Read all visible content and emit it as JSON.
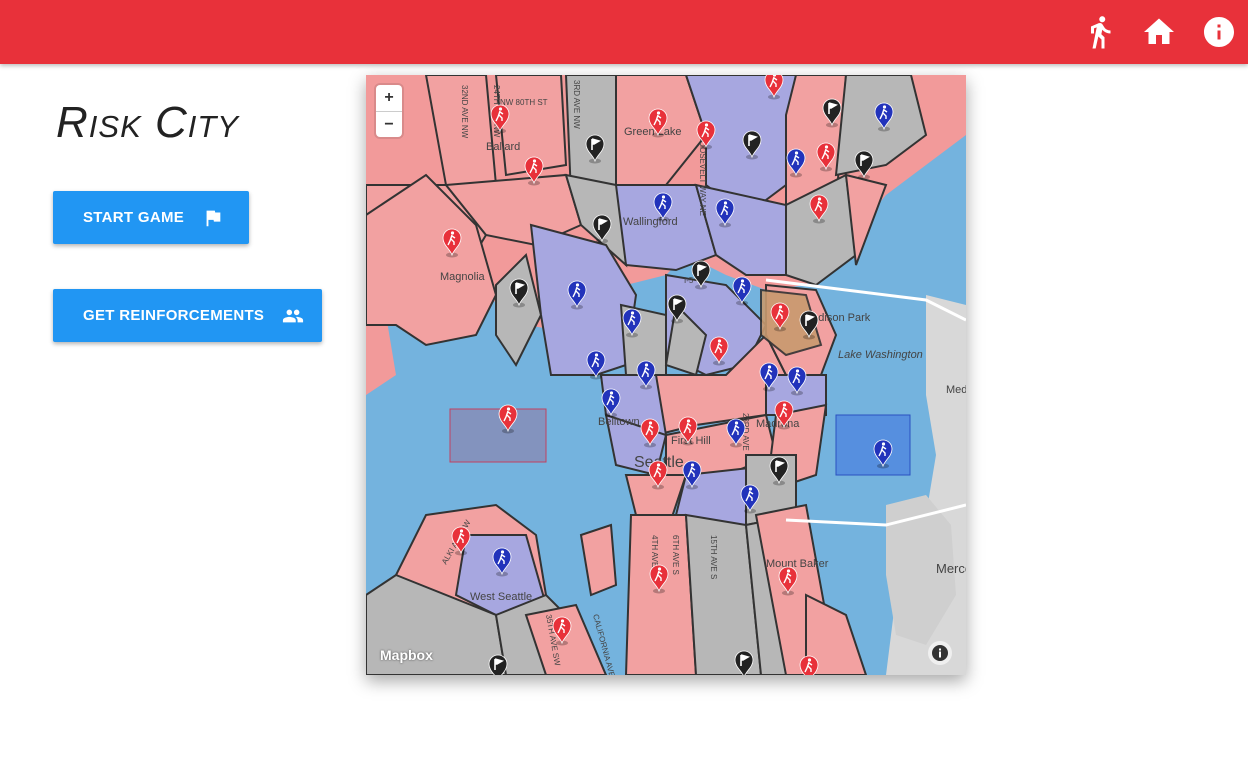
{
  "header": {
    "icons": [
      "walk-icon",
      "home-icon",
      "info-icon"
    ]
  },
  "title": "Risk City",
  "buttons": {
    "start_game": "START GAME",
    "get_reinforcements": "GET REINFORCEMENTS"
  },
  "map": {
    "zoom_in": "+",
    "zoom_out": "−",
    "attribution": "Mapbox",
    "labels": [
      "Ballard",
      "Green Lake",
      "Wallingford",
      "Magnolia",
      "Madison Park",
      "Lake Washington",
      "Belltown",
      "First Hill",
      "Seattle",
      "Madrona",
      "West Seattle",
      "Mount Baker",
      "Mercer Island",
      "Medina"
    ],
    "street_labels": [
      "32ND AVE NW",
      "24TH AVE NW",
      "NW 80TH ST",
      "3RD AVE NW",
      "ROOSEVELT WAY NE",
      "I-5",
      "23RD AVE",
      "4TH AVE S",
      "6TH AVE S",
      "15TH AVE S",
      "ALKI AVE SW",
      "CALIFORNIA AVE SW",
      "35TH AVE SW"
    ]
  },
  "colors": {
    "topbar": "#e8313a",
    "button": "#2196f3",
    "red_team": "#e8313a",
    "blue_team": "#2233bb",
    "neutral": "#222222"
  }
}
